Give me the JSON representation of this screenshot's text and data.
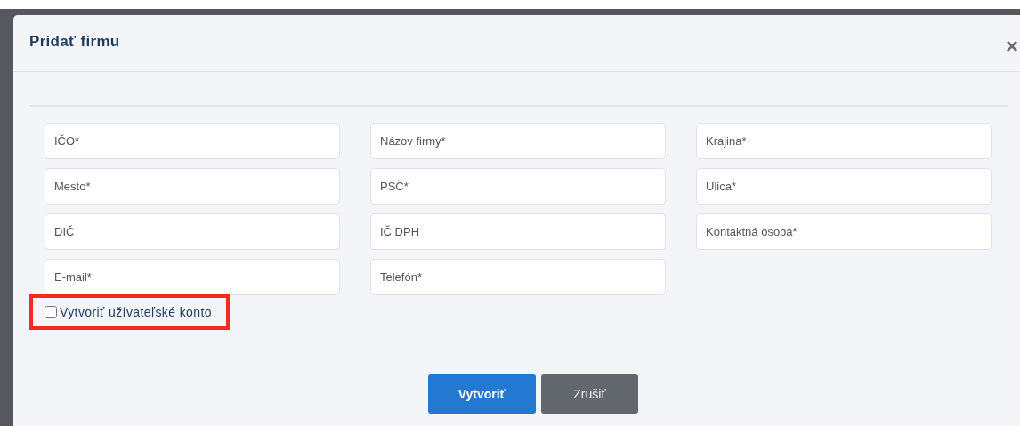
{
  "dialog": {
    "title": "Pridať firmu",
    "close": "×"
  },
  "fields": [
    {
      "placeholder": "IČO*"
    },
    {
      "placeholder": "Názov firmy*"
    },
    {
      "placeholder": "Krajina*"
    },
    {
      "placeholder": "Mesto*"
    },
    {
      "placeholder": "PSČ*"
    },
    {
      "placeholder": "Ulica*"
    },
    {
      "placeholder": "DIČ"
    },
    {
      "placeholder": "IČ DPH"
    },
    {
      "placeholder": "Kontaktná osoba*"
    },
    {
      "placeholder": "E-mail*"
    },
    {
      "placeholder": "Telefón*"
    }
  ],
  "account_checkbox": {
    "label": "Vytvoriť užívateľské konto",
    "checked": false,
    "highlighted": true
  },
  "buttons": [
    {
      "label": "Vytvoriť",
      "kind": "primary"
    },
    {
      "label": "Zrušiť",
      "kind": "secondary"
    }
  ]
}
